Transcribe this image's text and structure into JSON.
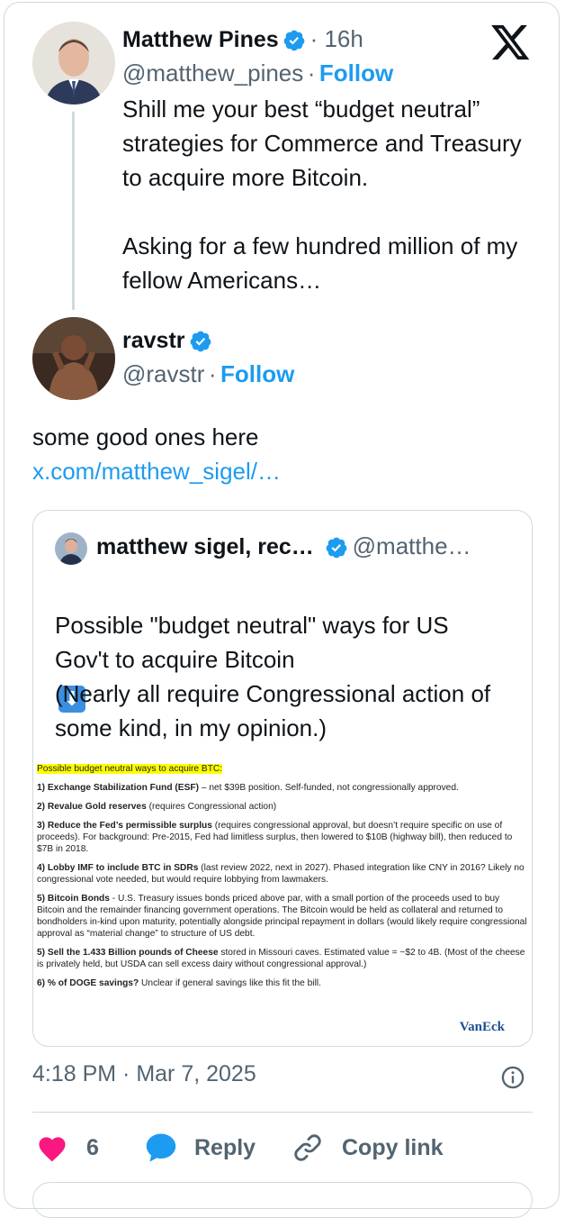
{
  "main_tweet": {
    "author_name": "Matthew Pines",
    "handle": "@matthew_pines",
    "time": "· 16h",
    "follow_label": "Follow",
    "separator": "·",
    "text": "Shill me your best “budget neutral” strategies for Commerce and Treasury to acquire more Bitcoin.\n\nAsking for a few hundred million of my fellow Americans…"
  },
  "reply_tweet": {
    "author_name": "ravstr",
    "handle": "@ravstr",
    "separator": "·",
    "follow_label": "Follow",
    "text": "some good ones here",
    "link": "x.com/matthew_sigel/…"
  },
  "quoted_tweet": {
    "author_name": "matthew sigel, rec…",
    "handle": "@matthe…",
    "text": "Possible \"budget neutral\" ways for US Gov't to acquire Bitcoin",
    "emoji": "⬇",
    "text2": "(Nearly all require Congressional action of some kind, in my opinion.)"
  },
  "document": {
    "heading": "Possible budget neutral ways to acquire BTC:",
    "items": [
      {
        "bold": "1) Exchange Stabilization Fund (ESF)",
        "rest": " – net $39B position. Self-funded, not congressionally approved."
      },
      {
        "bold": "2) Revalue Gold reserves",
        "rest": " (requires Congressional action)"
      },
      {
        "bold": "3) Reduce the Fed’s permissible surplus",
        "rest": " (requires congressional approval, but doesn’t require specific on use of proceeds). For background: Pre-2015, Fed had limitless surplus, then lowered to $10B (highway bill), then reduced to $7B in 2018."
      },
      {
        "bold": "4) Lobby IMF to include BTC in SDRs",
        "rest": " (last review 2022, next in 2027). Phased integration like CNY in 2016? Likely no congressional vote needed, but would require lobbying from lawmakers."
      },
      {
        "bold": "5) Bitcoin Bonds",
        "rest": " - U.S. Treasury issues bonds priced above par, with a small portion of the proceeds used to buy Bitcoin and the remainder financing government operations. The Bitcoin would be held as collateral and returned to bondholders in-kind upon maturity, potentially alongside principal repayment in dollars (would likely require congressional approval as “material change” to structure of US debt."
      },
      {
        "bold": "5) Sell the 1.433 Billion pounds of Cheese",
        "rest": " stored in Missouri caves. Estimated value = ~$2 to 4B. (Most of the cheese is privately held, but USDA can sell excess dairy without congressional approval.)"
      },
      {
        "bold": "6) % of DOGE savings?",
        "rest": " Unclear if general savings like this fit the bill."
      }
    ],
    "logo": "VanEck"
  },
  "timestamp": "4:18 PM · Mar 7, 2025",
  "actions": {
    "like_count": "6",
    "reply_label": "Reply",
    "copy_link_label": "Copy link"
  },
  "colors": {
    "accent": "#1d9bf0",
    "like": "#f91880",
    "muted": "#536471",
    "border": "#cfd9de"
  }
}
